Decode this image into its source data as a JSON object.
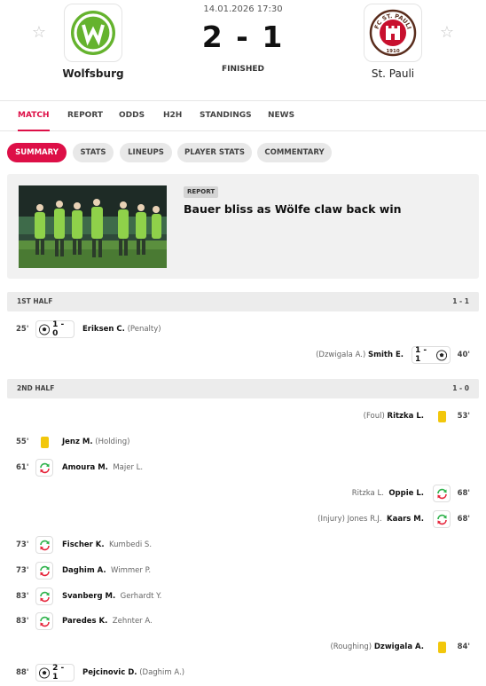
{
  "match": {
    "date_time": "14.01.2026 17:30",
    "score": "2 - 1",
    "status": "FINISHED",
    "home_team": "Wolfsburg",
    "away_team": "St. Pauli"
  },
  "colors": {
    "accent": "#dd0f47",
    "wolfsburg_green": "#65b32e",
    "st_pauli_brown": "#5a2d1d",
    "st_pauli_red": "#c8102e",
    "yellow_card": "#f2c70b",
    "sub_in": "#2fb24c",
    "sub_out": "#e6243a"
  },
  "main_tabs": [
    "MATCH",
    "REPORT",
    "ODDS",
    "H2H",
    "STANDINGS",
    "NEWS"
  ],
  "sub_tabs": [
    "SUMMARY",
    "STATS",
    "LINEUPS",
    "PLAYER STATS",
    "COMMENTARY"
  ],
  "article": {
    "badge": "REPORT",
    "title": "Bauer bliss as Wölfe claw back win"
  },
  "crest_texts": {
    "st_pauli_ring": "FC ST. PAULI",
    "st_pauli_year": "1910"
  },
  "sections": [
    {
      "title": "1ST HALF",
      "score": "1 - 1",
      "incidents": [
        {
          "side": "home",
          "minute": "25'",
          "type": "goal",
          "score": "1 - 0",
          "player": "Eriksen C.",
          "detail": "(Penalty)"
        },
        {
          "side": "away",
          "minute": "40'",
          "type": "goal",
          "score": "1 - 1",
          "player": "Smith E.",
          "detail": "(Dzwigala A.)"
        }
      ]
    },
    {
      "title": "2ND HALF",
      "score": "1 - 0",
      "incidents": [
        {
          "side": "away",
          "minute": "53'",
          "type": "yellow",
          "player": "Ritzka L.",
          "detail": "(Foul)"
        },
        {
          "side": "home",
          "minute": "55'",
          "type": "yellow",
          "player": "Jenz M.",
          "detail": "(Holding)"
        },
        {
          "side": "home",
          "minute": "61'",
          "type": "sub",
          "player": "Amoura M.",
          "detail": "Majer L."
        },
        {
          "side": "away",
          "minute": "68'",
          "type": "sub",
          "player": "Oppie L.",
          "detail": "Ritzka L."
        },
        {
          "side": "away",
          "minute": "68'",
          "type": "sub",
          "player": "Kaars M.",
          "detail": "(Injury) Jones R.J."
        },
        {
          "side": "home",
          "minute": "73'",
          "type": "sub",
          "player": "Fischer K.",
          "detail": "Kumbedi S."
        },
        {
          "side": "home",
          "minute": "73'",
          "type": "sub",
          "player": "Daghim A.",
          "detail": "Wimmer P."
        },
        {
          "side": "home",
          "minute": "83'",
          "type": "sub",
          "player": "Svanberg M.",
          "detail": "Gerhardt Y."
        },
        {
          "side": "home",
          "minute": "83'",
          "type": "sub",
          "player": "Paredes K.",
          "detail": "Zehnter A."
        },
        {
          "side": "away",
          "minute": "84'",
          "type": "yellow",
          "player": "Dzwigala A.",
          "detail": "(Roughing)"
        },
        {
          "side": "home",
          "minute": "88'",
          "type": "goal",
          "score": "2 - 1",
          "player": "Pejcinovic D.",
          "detail": "(Daghim A.)"
        }
      ]
    }
  ]
}
